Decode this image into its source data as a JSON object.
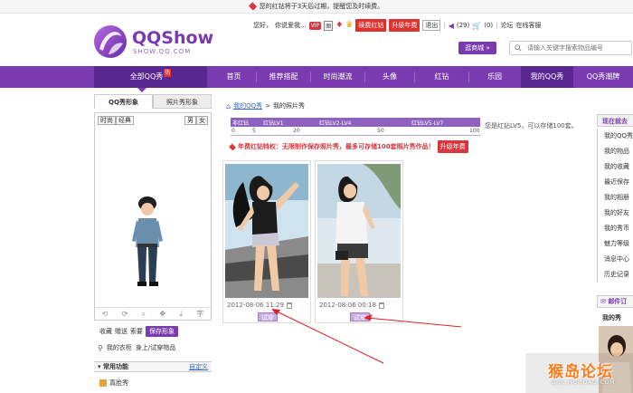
{
  "notice": {
    "text": "您的红钻将于3天后过期，提醒您及时续费。"
  },
  "brand": {
    "title": "QQShow",
    "subtitle": "SHOW.QQ.COM"
  },
  "userbar": {
    "greeting": "您好，",
    "nickname": "你说爱我...",
    "vip_badge": "VIP",
    "icon_label": "图",
    "renew_label": "续费红钻",
    "upgrade_label": "升级年费",
    "exit_label": "退出",
    "messages": "(29)",
    "cart": "(0)",
    "forum": "论坛",
    "guestbook": "在线客服"
  },
  "header": {
    "mall_button": "逛商城 »",
    "search_placeholder": "请输入关键字搜索物品编号"
  },
  "nav": {
    "items": [
      {
        "label": "全部QQ秀",
        "hot": "热"
      },
      {
        "label": "首页"
      },
      {
        "label": "推荐搭配"
      },
      {
        "label": "时尚潮流"
      },
      {
        "label": "头像"
      },
      {
        "label": "红钻"
      },
      {
        "label": "乐园"
      },
      {
        "label": "我的QQ秀"
      },
      {
        "label": "QQ秀潮牌"
      }
    ]
  },
  "left": {
    "tabs": [
      "QQ秀形象",
      "照片秀形象"
    ],
    "view_tabs": [
      "时尚",
      "经典"
    ],
    "gender": [
      "男",
      "女"
    ],
    "controls": [
      "⟲",
      "⟳",
      "⌕",
      "✥",
      "⤓",
      "字"
    ],
    "actions": [
      "收藏",
      "赠送",
      "索要",
      "保存形象"
    ],
    "closet": [
      "我的衣柜",
      "身上/试穿物品"
    ],
    "common_title": "常用功能",
    "common_custom": "自定义",
    "trueface": "真脸秀"
  },
  "main": {
    "breadcrumb": [
      "我的QQ秀",
      "我的照片秀"
    ],
    "levels": {
      "labels": [
        "非红钻",
        "红钻LV1",
        "红钻LV2-LV4",
        "红钻LV5-LV7"
      ],
      "ticks": [
        "0",
        "5",
        "20",
        "50",
        "100"
      ],
      "status": "您是红钻LV5，可以存储100套。"
    },
    "privilege": {
      "text": "年费红钻特权：无限制作保存照片秀，最多可存储100套照片秀作品！",
      "button": "升级年费"
    },
    "photos": [
      {
        "date": "2012-08-06 11:29",
        "try_label": "试穿"
      },
      {
        "date": "2012-08-06 00:18",
        "try_label": "试穿"
      }
    ]
  },
  "right": {
    "title": "现在就去",
    "items": [
      "我的QQ秀",
      "我的物品",
      "我的收藏",
      "最近保存",
      "我的相册",
      "我的好友",
      "我的秀币",
      "魅力等级",
      "消息中心",
      "历史记录"
    ],
    "mail": "邮件订",
    "my_label": "我的秀"
  },
  "watermark": {
    "main": "猴岛论坛",
    "sub": "BBS.HOUDAO.COM"
  },
  "colors": {
    "brand_purple": "#7a3bb0",
    "dark_purple": "#5a2690",
    "alert_red": "#d9363e"
  }
}
